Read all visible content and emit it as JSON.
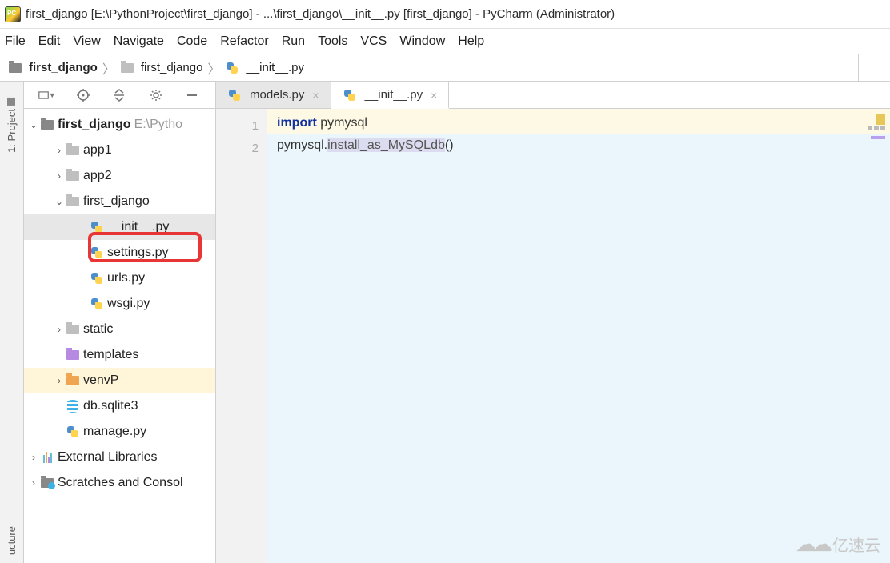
{
  "window": {
    "title": "first_django [E:\\PythonProject\\first_django] - ...\\first_django\\__init__.py [first_django] - PyCharm (Administrator)"
  },
  "menu": [
    "File",
    "Edit",
    "View",
    "Navigate",
    "Code",
    "Refactor",
    "Run",
    "Tools",
    "VCS",
    "Window",
    "Help"
  ],
  "breadcrumb": {
    "items": [
      "first_django",
      "first_django",
      "__init__.py"
    ]
  },
  "side_tabs": {
    "project": "1: Project",
    "structure": "ucture"
  },
  "tree": {
    "root": {
      "name": "first_django",
      "path": "E:\\Pytho"
    },
    "items": [
      {
        "name": "app1",
        "icon": "folder-light",
        "depth": 1,
        "expander": "›"
      },
      {
        "name": "app2",
        "icon": "folder-light",
        "depth": 1,
        "expander": "›"
      },
      {
        "name": "first_django",
        "icon": "folder-light",
        "depth": 1,
        "expander": "v"
      },
      {
        "name": "__init__.py",
        "icon": "py",
        "depth": 2,
        "expander": "",
        "selected": true,
        "highlight": true
      },
      {
        "name": "settings.py",
        "icon": "py",
        "depth": 2,
        "expander": ""
      },
      {
        "name": "urls.py",
        "icon": "py",
        "depth": 2,
        "expander": ""
      },
      {
        "name": "wsgi.py",
        "icon": "py",
        "depth": 2,
        "expander": ""
      },
      {
        "name": "static",
        "icon": "folder-light",
        "depth": 1,
        "expander": "›"
      },
      {
        "name": "templates",
        "icon": "folder-purple",
        "depth": 1,
        "expander": ""
      },
      {
        "name": "venvP",
        "icon": "folder-orange",
        "depth": 1,
        "expander": "›",
        "venv": true
      },
      {
        "name": "db.sqlite3",
        "icon": "db",
        "depth": 1,
        "expander": ""
      },
      {
        "name": "manage.py",
        "icon": "py",
        "depth": 1,
        "expander": ""
      }
    ],
    "external": "External Libraries",
    "scratches": "Scratches and Consol"
  },
  "tabs": [
    {
      "name": "models.py",
      "active": false
    },
    {
      "name": "__init__.py",
      "active": true
    }
  ],
  "code": {
    "line_numbers": [
      "1",
      "2"
    ],
    "l1_kw": "import",
    "l1_mod": " pymysql",
    "l2_pre": "pymysql.",
    "l2_call": "install_as_MySQLdb",
    "l2_paren": "()"
  },
  "watermark": "亿速云"
}
